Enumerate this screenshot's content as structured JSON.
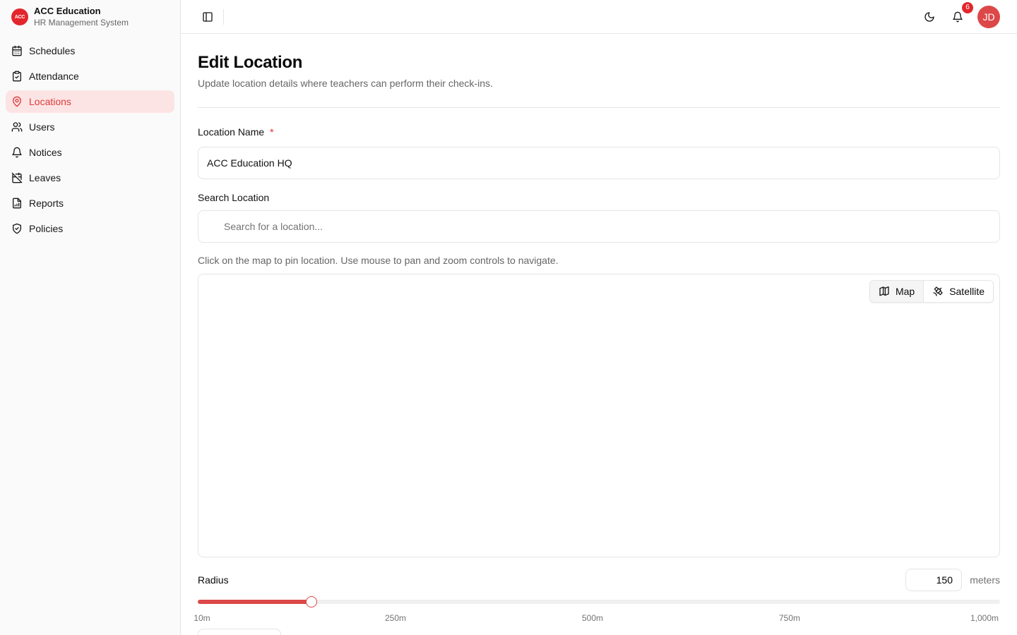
{
  "brand": {
    "logo_text": "ACC",
    "title": "ACC Education",
    "subtitle": "HR Management System"
  },
  "sidebar": {
    "items": [
      {
        "label": "Schedules",
        "icon": "calendar-icon"
      },
      {
        "label": "Attendance",
        "icon": "clipboard-check-icon"
      },
      {
        "label": "Locations",
        "icon": "map-pin-icon",
        "active": true
      },
      {
        "label": "Users",
        "icon": "users-icon"
      },
      {
        "label": "Notices",
        "icon": "bell-icon"
      },
      {
        "label": "Leaves",
        "icon": "calendar-off-icon"
      },
      {
        "label": "Reports",
        "icon": "file-chart-icon"
      },
      {
        "label": "Policies",
        "icon": "shield-check-icon"
      }
    ]
  },
  "topbar": {
    "notification_count": "6",
    "avatar_initials": "JD"
  },
  "page": {
    "title": "Edit Location",
    "subtitle": "Update location details where teachers can perform their check-ins."
  },
  "form": {
    "name_label": "Location Name",
    "required_mark": "*",
    "name_value": "ACC Education HQ",
    "search_label": "Search Location",
    "search_placeholder": "Search for a location...",
    "map_hint": "Click on the map to pin location. Use mouse to pan and zoom controls to navigate.",
    "map_tabs": {
      "map": "Map",
      "satellite": "Satellite"
    },
    "radius_label": "Radius",
    "radius_value": "150",
    "radius_unit": "meters",
    "radius_min": 10,
    "radius_max": 1000,
    "radius_ticks": [
      "10m",
      "250m",
      "500m",
      "750m",
      "1,000m"
    ]
  },
  "colors": {
    "accent": "#dc4848",
    "active_bg": "#fde4e4",
    "brand_red": "#e3262c"
  }
}
